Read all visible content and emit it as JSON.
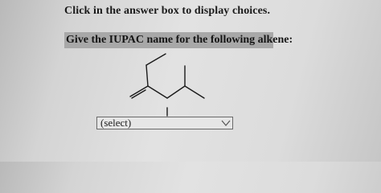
{
  "instruction": "Click in the answer box to display choices.",
  "question": "Give the IUPAC name for the following alkene:",
  "structure": {
    "type": "skeletal-formula",
    "depicts": "alkene"
  },
  "answer_select": {
    "value": "(select)",
    "icon": "chevron-down-icon"
  }
}
